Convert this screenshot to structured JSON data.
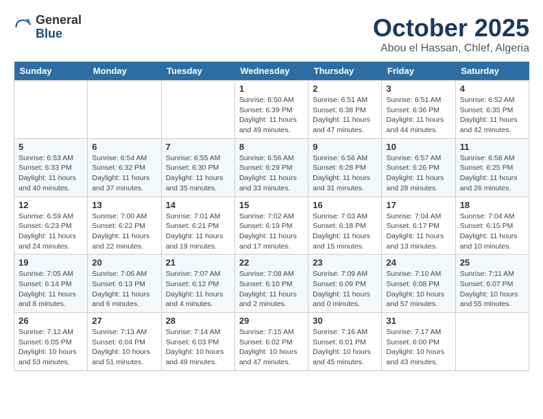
{
  "logo": {
    "general": "General",
    "blue": "Blue"
  },
  "header": {
    "month": "October 2025",
    "location": "Abou el Hassan, Chlef, Algeria"
  },
  "weekdays": [
    "Sunday",
    "Monday",
    "Tuesday",
    "Wednesday",
    "Thursday",
    "Friday",
    "Saturday"
  ],
  "weeks": [
    [
      {
        "day": "",
        "info": ""
      },
      {
        "day": "",
        "info": ""
      },
      {
        "day": "",
        "info": ""
      },
      {
        "day": "1",
        "info": "Sunrise: 6:50 AM\nSunset: 6:39 PM\nDaylight: 11 hours and 49 minutes."
      },
      {
        "day": "2",
        "info": "Sunrise: 6:51 AM\nSunset: 6:38 PM\nDaylight: 11 hours and 47 minutes."
      },
      {
        "day": "3",
        "info": "Sunrise: 6:51 AM\nSunset: 6:36 PM\nDaylight: 11 hours and 44 minutes."
      },
      {
        "day": "4",
        "info": "Sunrise: 6:52 AM\nSunset: 6:35 PM\nDaylight: 11 hours and 42 minutes."
      }
    ],
    [
      {
        "day": "5",
        "info": "Sunrise: 6:53 AM\nSunset: 6:33 PM\nDaylight: 11 hours and 40 minutes."
      },
      {
        "day": "6",
        "info": "Sunrise: 6:54 AM\nSunset: 6:32 PM\nDaylight: 11 hours and 37 minutes."
      },
      {
        "day": "7",
        "info": "Sunrise: 6:55 AM\nSunset: 6:30 PM\nDaylight: 11 hours and 35 minutes."
      },
      {
        "day": "8",
        "info": "Sunrise: 6:56 AM\nSunset: 6:29 PM\nDaylight: 11 hours and 33 minutes."
      },
      {
        "day": "9",
        "info": "Sunrise: 6:56 AM\nSunset: 6:28 PM\nDaylight: 11 hours and 31 minutes."
      },
      {
        "day": "10",
        "info": "Sunrise: 6:57 AM\nSunset: 6:26 PM\nDaylight: 11 hours and 28 minutes."
      },
      {
        "day": "11",
        "info": "Sunrise: 6:58 AM\nSunset: 6:25 PM\nDaylight: 11 hours and 26 minutes."
      }
    ],
    [
      {
        "day": "12",
        "info": "Sunrise: 6:59 AM\nSunset: 6:23 PM\nDaylight: 11 hours and 24 minutes."
      },
      {
        "day": "13",
        "info": "Sunrise: 7:00 AM\nSunset: 6:22 PM\nDaylight: 11 hours and 22 minutes."
      },
      {
        "day": "14",
        "info": "Sunrise: 7:01 AM\nSunset: 6:21 PM\nDaylight: 11 hours and 19 minutes."
      },
      {
        "day": "15",
        "info": "Sunrise: 7:02 AM\nSunset: 6:19 PM\nDaylight: 11 hours and 17 minutes."
      },
      {
        "day": "16",
        "info": "Sunrise: 7:03 AM\nSunset: 6:18 PM\nDaylight: 11 hours and 15 minutes."
      },
      {
        "day": "17",
        "info": "Sunrise: 7:04 AM\nSunset: 6:17 PM\nDaylight: 11 hours and 13 minutes."
      },
      {
        "day": "18",
        "info": "Sunrise: 7:04 AM\nSunset: 6:15 PM\nDaylight: 11 hours and 10 minutes."
      }
    ],
    [
      {
        "day": "19",
        "info": "Sunrise: 7:05 AM\nSunset: 6:14 PM\nDaylight: 11 hours and 8 minutes."
      },
      {
        "day": "20",
        "info": "Sunrise: 7:06 AM\nSunset: 6:13 PM\nDaylight: 11 hours and 6 minutes."
      },
      {
        "day": "21",
        "info": "Sunrise: 7:07 AM\nSunset: 6:12 PM\nDaylight: 11 hours and 4 minutes."
      },
      {
        "day": "22",
        "info": "Sunrise: 7:08 AM\nSunset: 6:10 PM\nDaylight: 11 hours and 2 minutes."
      },
      {
        "day": "23",
        "info": "Sunrise: 7:09 AM\nSunset: 6:09 PM\nDaylight: 11 hours and 0 minutes."
      },
      {
        "day": "24",
        "info": "Sunrise: 7:10 AM\nSunset: 6:08 PM\nDaylight: 10 hours and 57 minutes."
      },
      {
        "day": "25",
        "info": "Sunrise: 7:11 AM\nSunset: 6:07 PM\nDaylight: 10 hours and 55 minutes."
      }
    ],
    [
      {
        "day": "26",
        "info": "Sunrise: 7:12 AM\nSunset: 6:05 PM\nDaylight: 10 hours and 53 minutes."
      },
      {
        "day": "27",
        "info": "Sunrise: 7:13 AM\nSunset: 6:04 PM\nDaylight: 10 hours and 51 minutes."
      },
      {
        "day": "28",
        "info": "Sunrise: 7:14 AM\nSunset: 6:03 PM\nDaylight: 10 hours and 49 minutes."
      },
      {
        "day": "29",
        "info": "Sunrise: 7:15 AM\nSunset: 6:02 PM\nDaylight: 10 hours and 47 minutes."
      },
      {
        "day": "30",
        "info": "Sunrise: 7:16 AM\nSunset: 6:01 PM\nDaylight: 10 hours and 45 minutes."
      },
      {
        "day": "31",
        "info": "Sunrise: 7:17 AM\nSunset: 6:00 PM\nDaylight: 10 hours and 43 minutes."
      },
      {
        "day": "",
        "info": ""
      }
    ]
  ]
}
